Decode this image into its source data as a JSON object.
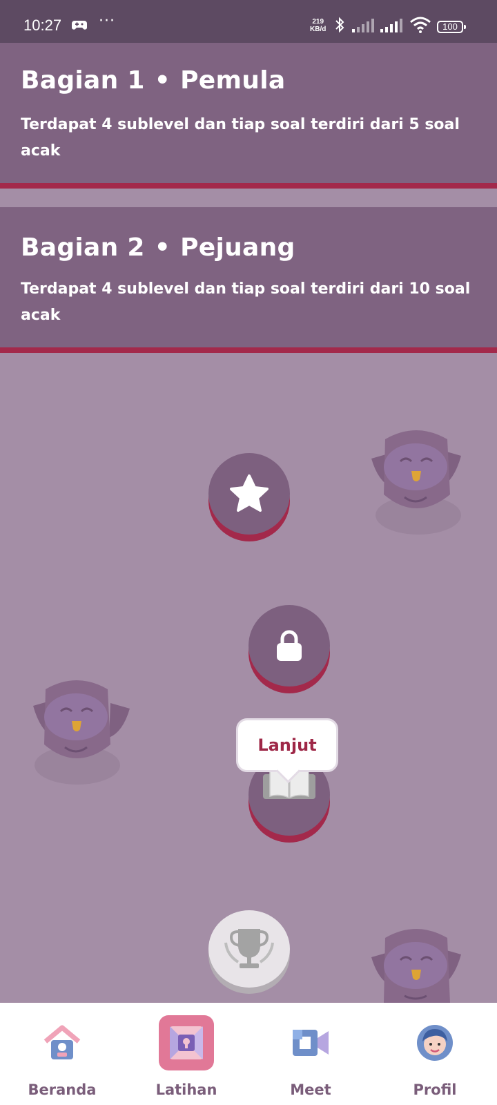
{
  "status_bar": {
    "time": "10:27",
    "more": "···",
    "net_speed_value": "219",
    "net_speed_unit": "KB/d",
    "battery": "100"
  },
  "sections": [
    {
      "title_part1": "Bagian 1",
      "separator": "•",
      "title_part2": "Pemula",
      "description": "Terdapat 4 sublevel dan tiap soal terdiri dari 5 soal acak"
    },
    {
      "title_part1": "Bagian 2",
      "separator": "•",
      "title_part2": "Pejuang",
      "description": "Terdapat 4 sublevel dan tiap soal terdiri dari 10 soal acak"
    }
  ],
  "path": {
    "nodes": [
      {
        "icon": "star-icon",
        "state": "completed"
      },
      {
        "icon": "lock-icon",
        "state": "locked"
      },
      {
        "icon": "book-icon",
        "state": "current"
      },
      {
        "icon": "trophy-icon",
        "state": "locked"
      }
    ],
    "tooltip": "Lanjut"
  },
  "bottom_nav": {
    "items": [
      {
        "label": "Beranda",
        "icon": "house-icon",
        "active": false
      },
      {
        "label": "Latihan",
        "icon": "practice-icon",
        "active": true
      },
      {
        "label": "Meet",
        "icon": "video-icon",
        "active": false
      },
      {
        "label": "Profil",
        "icon": "profile-icon",
        "active": false
      }
    ]
  },
  "colors": {
    "background": "#a48ea6",
    "section": "#7f6381",
    "accent": "#a3294b",
    "active_nav": "#e17897",
    "nav_label": "#7a5d7a"
  }
}
